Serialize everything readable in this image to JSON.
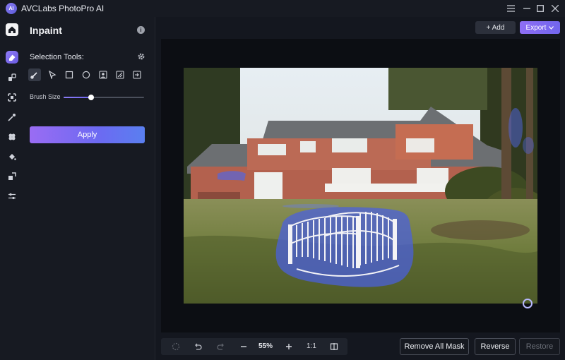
{
  "app": {
    "title": "AVCLabs PhotoPro AI",
    "logo_text": "AI"
  },
  "window": {
    "minimize": "–",
    "maximize": "□",
    "close": "✕",
    "menu": "≡"
  },
  "panel": {
    "title": "Inpaint",
    "section_label": "Selection Tools:",
    "brush_label": "Brush Size",
    "brush_size_fraction": 0.34,
    "apply_label": "Apply"
  },
  "header": {
    "add_label": "+ Add",
    "export_label": "Export"
  },
  "toolbar": {
    "zoom": "55%",
    "ratio": "1:1"
  },
  "actions": {
    "remove_all_mask": "Remove All Mask",
    "reverse": "Reverse",
    "restore": "Restore"
  },
  "colors": {
    "accent": "#7c6af2",
    "mask": "#4a5fe0"
  }
}
